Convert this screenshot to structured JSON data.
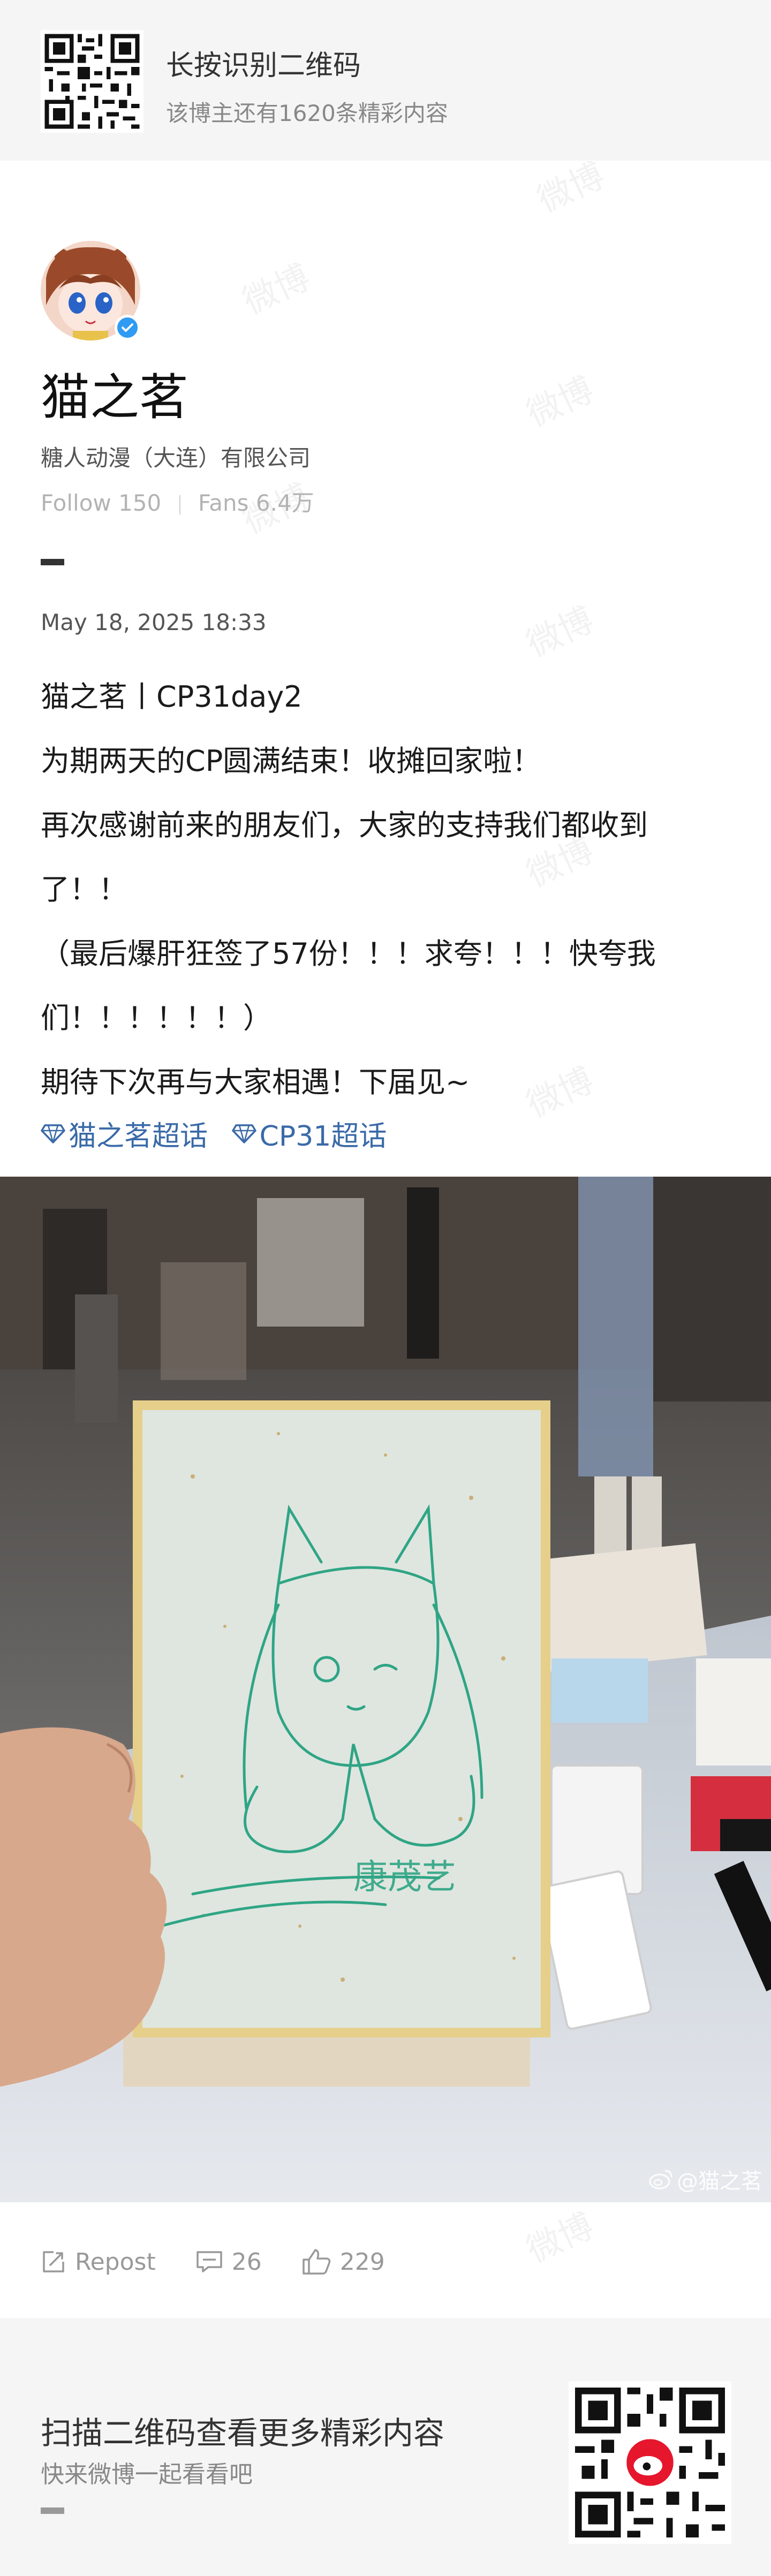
{
  "banner": {
    "title": "长按识别二维码",
    "subtitle": "该博主还有1620条精彩内容",
    "watermark": "微博"
  },
  "profile": {
    "name": "猫之茗",
    "company": "糖人动漫（大连）有限公司",
    "follow_label": "Follow",
    "follow_count": "150",
    "fans_label": "Fans",
    "fans_count": "6.4万",
    "verified": true
  },
  "post": {
    "date": "May 18, 2025 18:33",
    "lines": [
      "猫之茗丨CP31day2",
      "为期两天的CP圆满结束！收摊回家啦！",
      "再次感谢前来的朋友们，大家的支持我们都收到",
      "了！！",
      "（最后爆肝狂签了57份！！！求夸！！！快夸我",
      "们！！！！！！）",
      "期待下次再与大家相遇！下届见~"
    ],
    "topics": [
      "猫之茗超话",
      "CP31超话"
    ],
    "photo_watermark": "@猫之茗",
    "photo_sign_text": "康茂艺"
  },
  "actions": {
    "repost_label": "Repost",
    "comments": "26",
    "likes": "229"
  },
  "footer": {
    "title": "扫描二维码查看更多精彩内容",
    "subtitle": "快来微博一起看看吧"
  },
  "colors": {
    "accent": "#3a6aa8",
    "verify": "#2f9bf2",
    "banner_bg": "#f5f5f5"
  }
}
